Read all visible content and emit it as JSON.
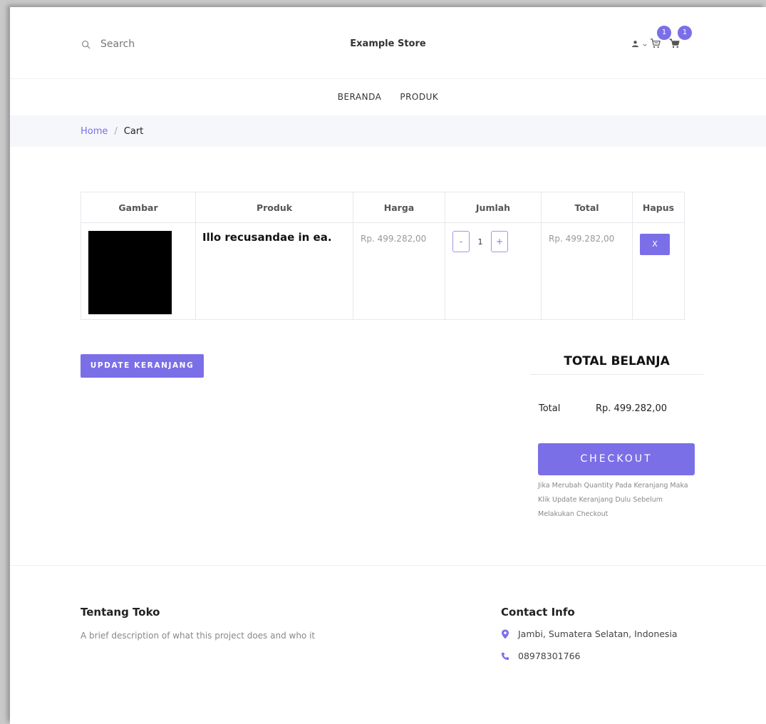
{
  "header": {
    "search_placeholder": "Search",
    "brand": "Example Store",
    "badges": {
      "wishlist": "1",
      "cart": "1"
    }
  },
  "nav": {
    "items": [
      "BERANDA",
      "PRODUK"
    ]
  },
  "breadcrumb": {
    "home": "Home",
    "separator": "/",
    "current": "Cart"
  },
  "cart": {
    "columns": [
      "Gambar",
      "Produk",
      "Harga",
      "Jumlah",
      "Total",
      "Hapus"
    ],
    "rows": [
      {
        "product": "Illo recusandae in ea.",
        "price": "Rp. 499.282,00",
        "qty_minus": "-",
        "quantity": "1",
        "qty_plus": "+",
        "total": "Rp. 499.282,00",
        "remove": "X"
      }
    ]
  },
  "update_button": "UPDATE KERANJANG",
  "summary": {
    "title": "TOTAL BELANJA",
    "total_label": "Total",
    "total_value": "Rp. 499.282,00",
    "checkout": "CHECKOUT",
    "note": "Jika Merubah Quantity Pada Keranjang Maka Klik Update Keranjang Dulu Sebelum Melakukan Checkout"
  },
  "footer": {
    "about_title": "Tentang Toko",
    "about_text": "A brief description of what this project does and who it",
    "contact_title": "Contact Info",
    "address": "Jambi, Sumatera Selatan, Indonesia",
    "phone": "08978301766"
  },
  "colors": {
    "accent": "#7b6fe8",
    "breadcrumb_bg": "#f5f7fa",
    "muted_text": "#888888"
  },
  "icons": [
    "search-icon",
    "user-icon",
    "chevron-down-icon",
    "wishlist-cart-icon",
    "cart-icon",
    "map-pin-icon",
    "phone-icon"
  ]
}
